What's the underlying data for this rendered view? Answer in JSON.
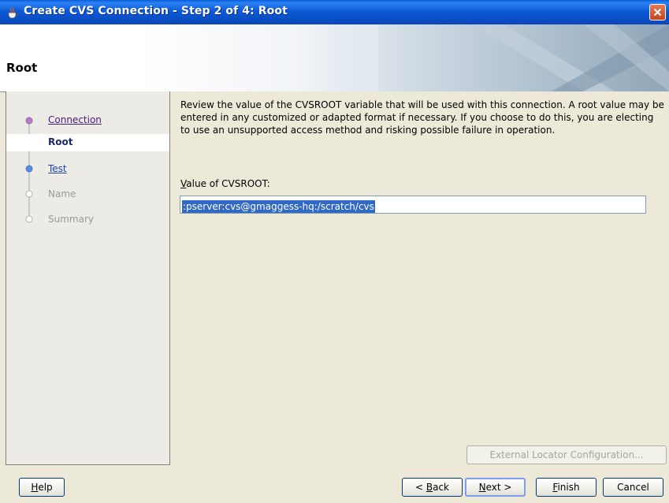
{
  "window": {
    "title": "Create CVS Connection - Step 2 of 4: Root"
  },
  "header": {
    "title": "Root"
  },
  "steps": [
    {
      "label": "Connection",
      "state": "visited"
    },
    {
      "label": "Root",
      "state": "current"
    },
    {
      "label": "Test",
      "state": "visited"
    },
    {
      "label": "Name",
      "state": "disabled"
    },
    {
      "label": "Summary",
      "state": "disabled"
    }
  ],
  "content": {
    "description": "Review the value of the CVSROOT variable that will be used with this connection. A root value may be entered in any customized or adapted format if necessary. If you choose to do this, you are electing to use an unsupported access method and risking possible failure in operation.",
    "field_label_mnemonic": "V",
    "field_label_rest": "alue of CVSROOT:",
    "cvsroot_value": ":pserver:cvs@gmaggess-hq:/scratch/cvs",
    "external_locator_label": "External Locator Configuration..."
  },
  "buttons": {
    "help_m": "H",
    "help_r": "elp",
    "back_pre": "< ",
    "back_m": "B",
    "back_r": "ack",
    "next_m": "N",
    "next_r": "ext >",
    "finish_m": "F",
    "finish_r": "inish",
    "cancel": "Cancel"
  },
  "colors": {
    "titlebar": "#0a5fd9",
    "selection": "#316ac5",
    "link": "#4b1b7a"
  }
}
